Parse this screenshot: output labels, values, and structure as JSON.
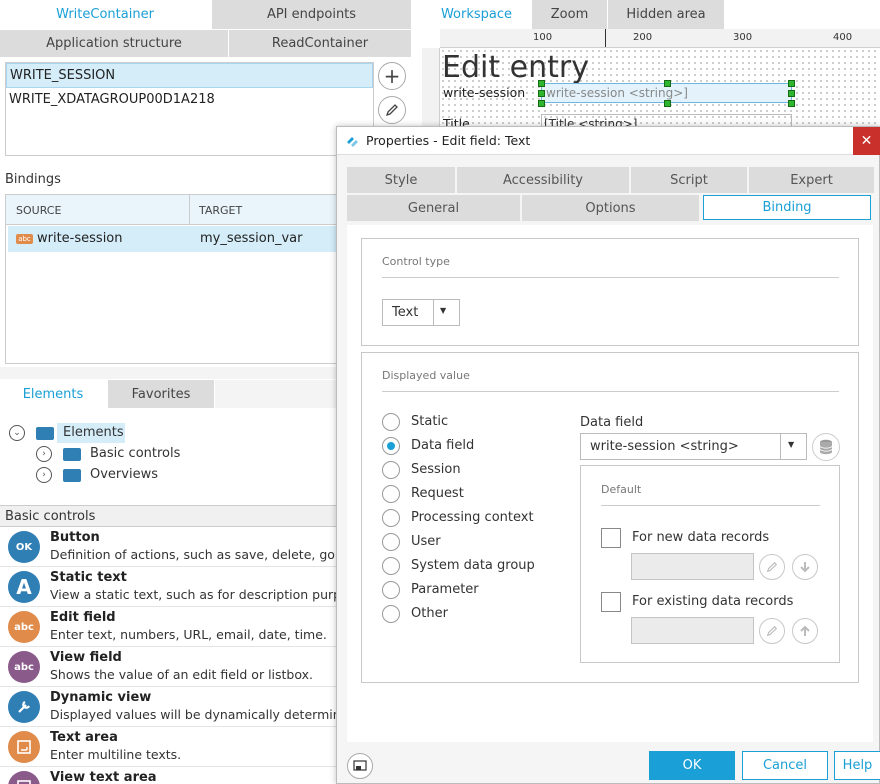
{
  "left_tabs_row1": [
    {
      "label": "WriteContainer",
      "active": true
    },
    {
      "label": "API endpoints",
      "active": false
    }
  ],
  "left_tabs_row2": [
    {
      "label": "Application structure"
    },
    {
      "label": "ReadContainer"
    }
  ],
  "containers": [
    "WRITE_SESSION",
    "WRITE_XDATAGROUP00D1A218"
  ],
  "bindings": {
    "title": "Bindings",
    "col_source": "SOURCE",
    "col_target": "TARGET",
    "rows": [
      {
        "icon_text": "abc",
        "source": "write-session",
        "target": "my_session_var"
      }
    ]
  },
  "element_tabs": [
    {
      "label": "Elements",
      "active": true
    },
    {
      "label": "Favorites",
      "active": false
    }
  ],
  "tree": {
    "root": "Elements",
    "children": [
      "Basic controls",
      "Overviews"
    ]
  },
  "basic_controls": {
    "header": "Basic controls",
    "items": [
      {
        "icon": "OK",
        "color": "#2f7fb5",
        "title": "Button",
        "desc": "Definition of actions, such as save, delete, go to,"
      },
      {
        "icon": "A",
        "color": "#2f7fb5",
        "title": "Static text",
        "desc": "View a static text, such as for description purpos"
      },
      {
        "icon": "abc",
        "color": "#e08b4a",
        "title": "Edit field",
        "desc": "Enter text, numbers, URL, email, date, time."
      },
      {
        "icon": "abc",
        "color": "#8a5a8a",
        "title": "View field",
        "desc": "Shows the value of an edit field or listbox."
      },
      {
        "icon": "wrench",
        "color": "#2f7fb5",
        "title": "Dynamic view",
        "desc": "Displayed values will be dynamically determined"
      },
      {
        "icon": "area",
        "color": "#e08b4a",
        "title": "Text area",
        "desc": "Enter multiline texts."
      },
      {
        "icon": "area",
        "color": "#8a5a8a",
        "title": "View text area",
        "desc": ""
      }
    ]
  },
  "workspace_tabs": [
    {
      "label": "Workspace",
      "active": true
    },
    {
      "label": "Zoom",
      "active": false
    },
    {
      "label": "Hidden area",
      "active": false
    }
  ],
  "ruler": [
    "100",
    "200",
    "300",
    "400"
  ],
  "canvas": {
    "heading": "Edit entry",
    "field_label": "write-session",
    "field_value": "write-session <string>]",
    "title_label": "Title",
    "title_value": "[Title <string>]"
  },
  "dialog": {
    "title": "Properties - Edit field: Text",
    "close": "✕",
    "tabs_row1": [
      "Style",
      "Accessibility",
      "Script",
      "Expert"
    ],
    "tabs_row2": [
      {
        "label": "General",
        "active": false
      },
      {
        "label": "Options",
        "active": false
      },
      {
        "label": "Binding",
        "active": true
      }
    ],
    "control_type": {
      "legend": "Control type",
      "value": "Text"
    },
    "displayed_value": {
      "legend": "Displayed value",
      "options": [
        {
          "label": "Static",
          "selected": false
        },
        {
          "label": "Data field",
          "selected": true
        },
        {
          "label": "Session",
          "selected": false
        },
        {
          "label": "Request",
          "selected": false
        },
        {
          "label": "Processing context",
          "selected": false
        },
        {
          "label": "User",
          "selected": false
        },
        {
          "label": "System data group",
          "selected": false
        },
        {
          "label": "Parameter",
          "selected": false
        },
        {
          "label": "Other",
          "selected": false
        }
      ],
      "data_field_label": "Data field",
      "data_field_value": "write-session <string>",
      "default_legend": "Default",
      "new_records": "For new data records",
      "existing_records": "For existing data records"
    },
    "buttons": {
      "ok": "OK",
      "cancel": "Cancel",
      "help": "Help"
    }
  },
  "colors": {
    "accent": "#1a9fd6",
    "close_red": "#c9302c",
    "selection": "#d4edf9"
  }
}
